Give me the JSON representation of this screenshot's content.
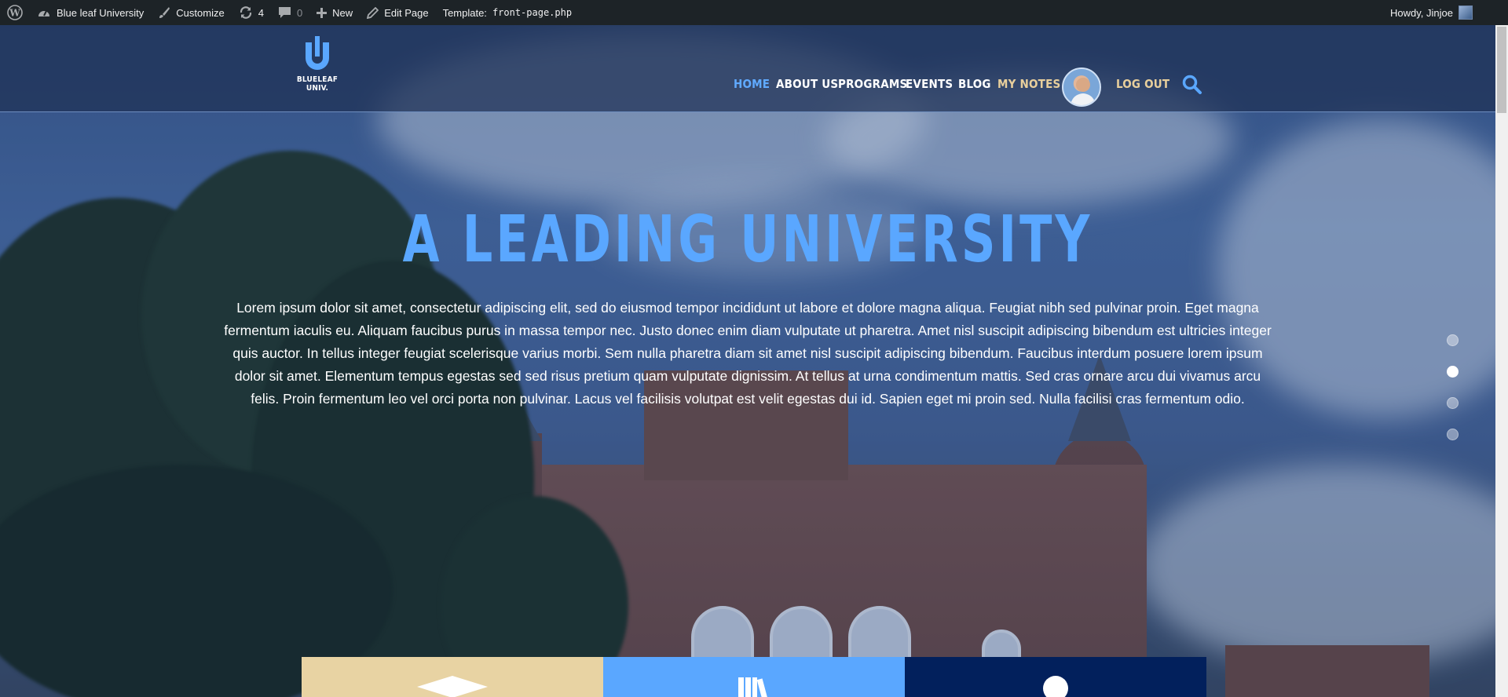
{
  "admin_bar": {
    "site_name": "Blue leaf University",
    "customize": "Customize",
    "updates_count": "4",
    "comments_count": "0",
    "new_label": "New",
    "edit_page": "Edit Page",
    "template_label": "Template:",
    "template_file": "front-page.php",
    "greeting": "Howdy, Jinjoe"
  },
  "header": {
    "logo_text": "BLUELEAF UNIV.",
    "nav": [
      {
        "label": "HOME",
        "state": "active"
      },
      {
        "label": "ABOUT US"
      },
      {
        "label": "PROGRAMS"
      },
      {
        "label": "EVENTS"
      },
      {
        "label": "BLOG"
      },
      {
        "label": "MY NOTES",
        "state": "highlight"
      },
      {
        "label": "LOG OUT",
        "state": "highlight"
      }
    ],
    "search_icon": "search-icon",
    "avatar_icon": "user-avatar"
  },
  "hero": {
    "title": "A LEADING UNIVERSITY",
    "body": "Lorem ipsum dolor sit amet, consectetur adipiscing elit, sed do eiusmod tempor incididunt ut labore et dolore magna aliqua. Feugiat nibh sed pulvinar proin. Eget magna fermentum iaculis eu. Aliquam faucibus purus in massa tempor nec. Justo donec enim diam vulputate ut pharetra. Amet nisl suscipit adipiscing bibendum est ultricies integer quis auctor. In tellus integer feugiat scelerisque varius morbi. Sem nulla pharetra diam sit amet nisl suscipit adipiscing bibendum. Faucibus interdum posuere lorem ipsum dolor sit amet. Elementum tempus egestas sed sed risus pretium quam vulputate dignissim. At tellus at urna condimentum mattis. Sed cras ornare arcu dui vivamus arcu felis. Proin fermentum leo vel orci porta non pulvinar. Lacus vel facilisis volutpat est velit egestas dui id. Sapien eget mi proin sed. Nulla facilisi cras fermentum odio.",
    "slides_total": 4,
    "slide_active": 2
  },
  "features": [
    {
      "icon": "graduation-cap-icon",
      "color": "#e8d3a3"
    },
    {
      "icon": "books-icon",
      "color": "#5aa7ff"
    },
    {
      "icon": "person-icon",
      "color": "#02205c"
    }
  ],
  "colors": {
    "accent_blue": "#5aa7ff",
    "gold": "#e8cf9c",
    "admin_bar": "#1d2327"
  }
}
